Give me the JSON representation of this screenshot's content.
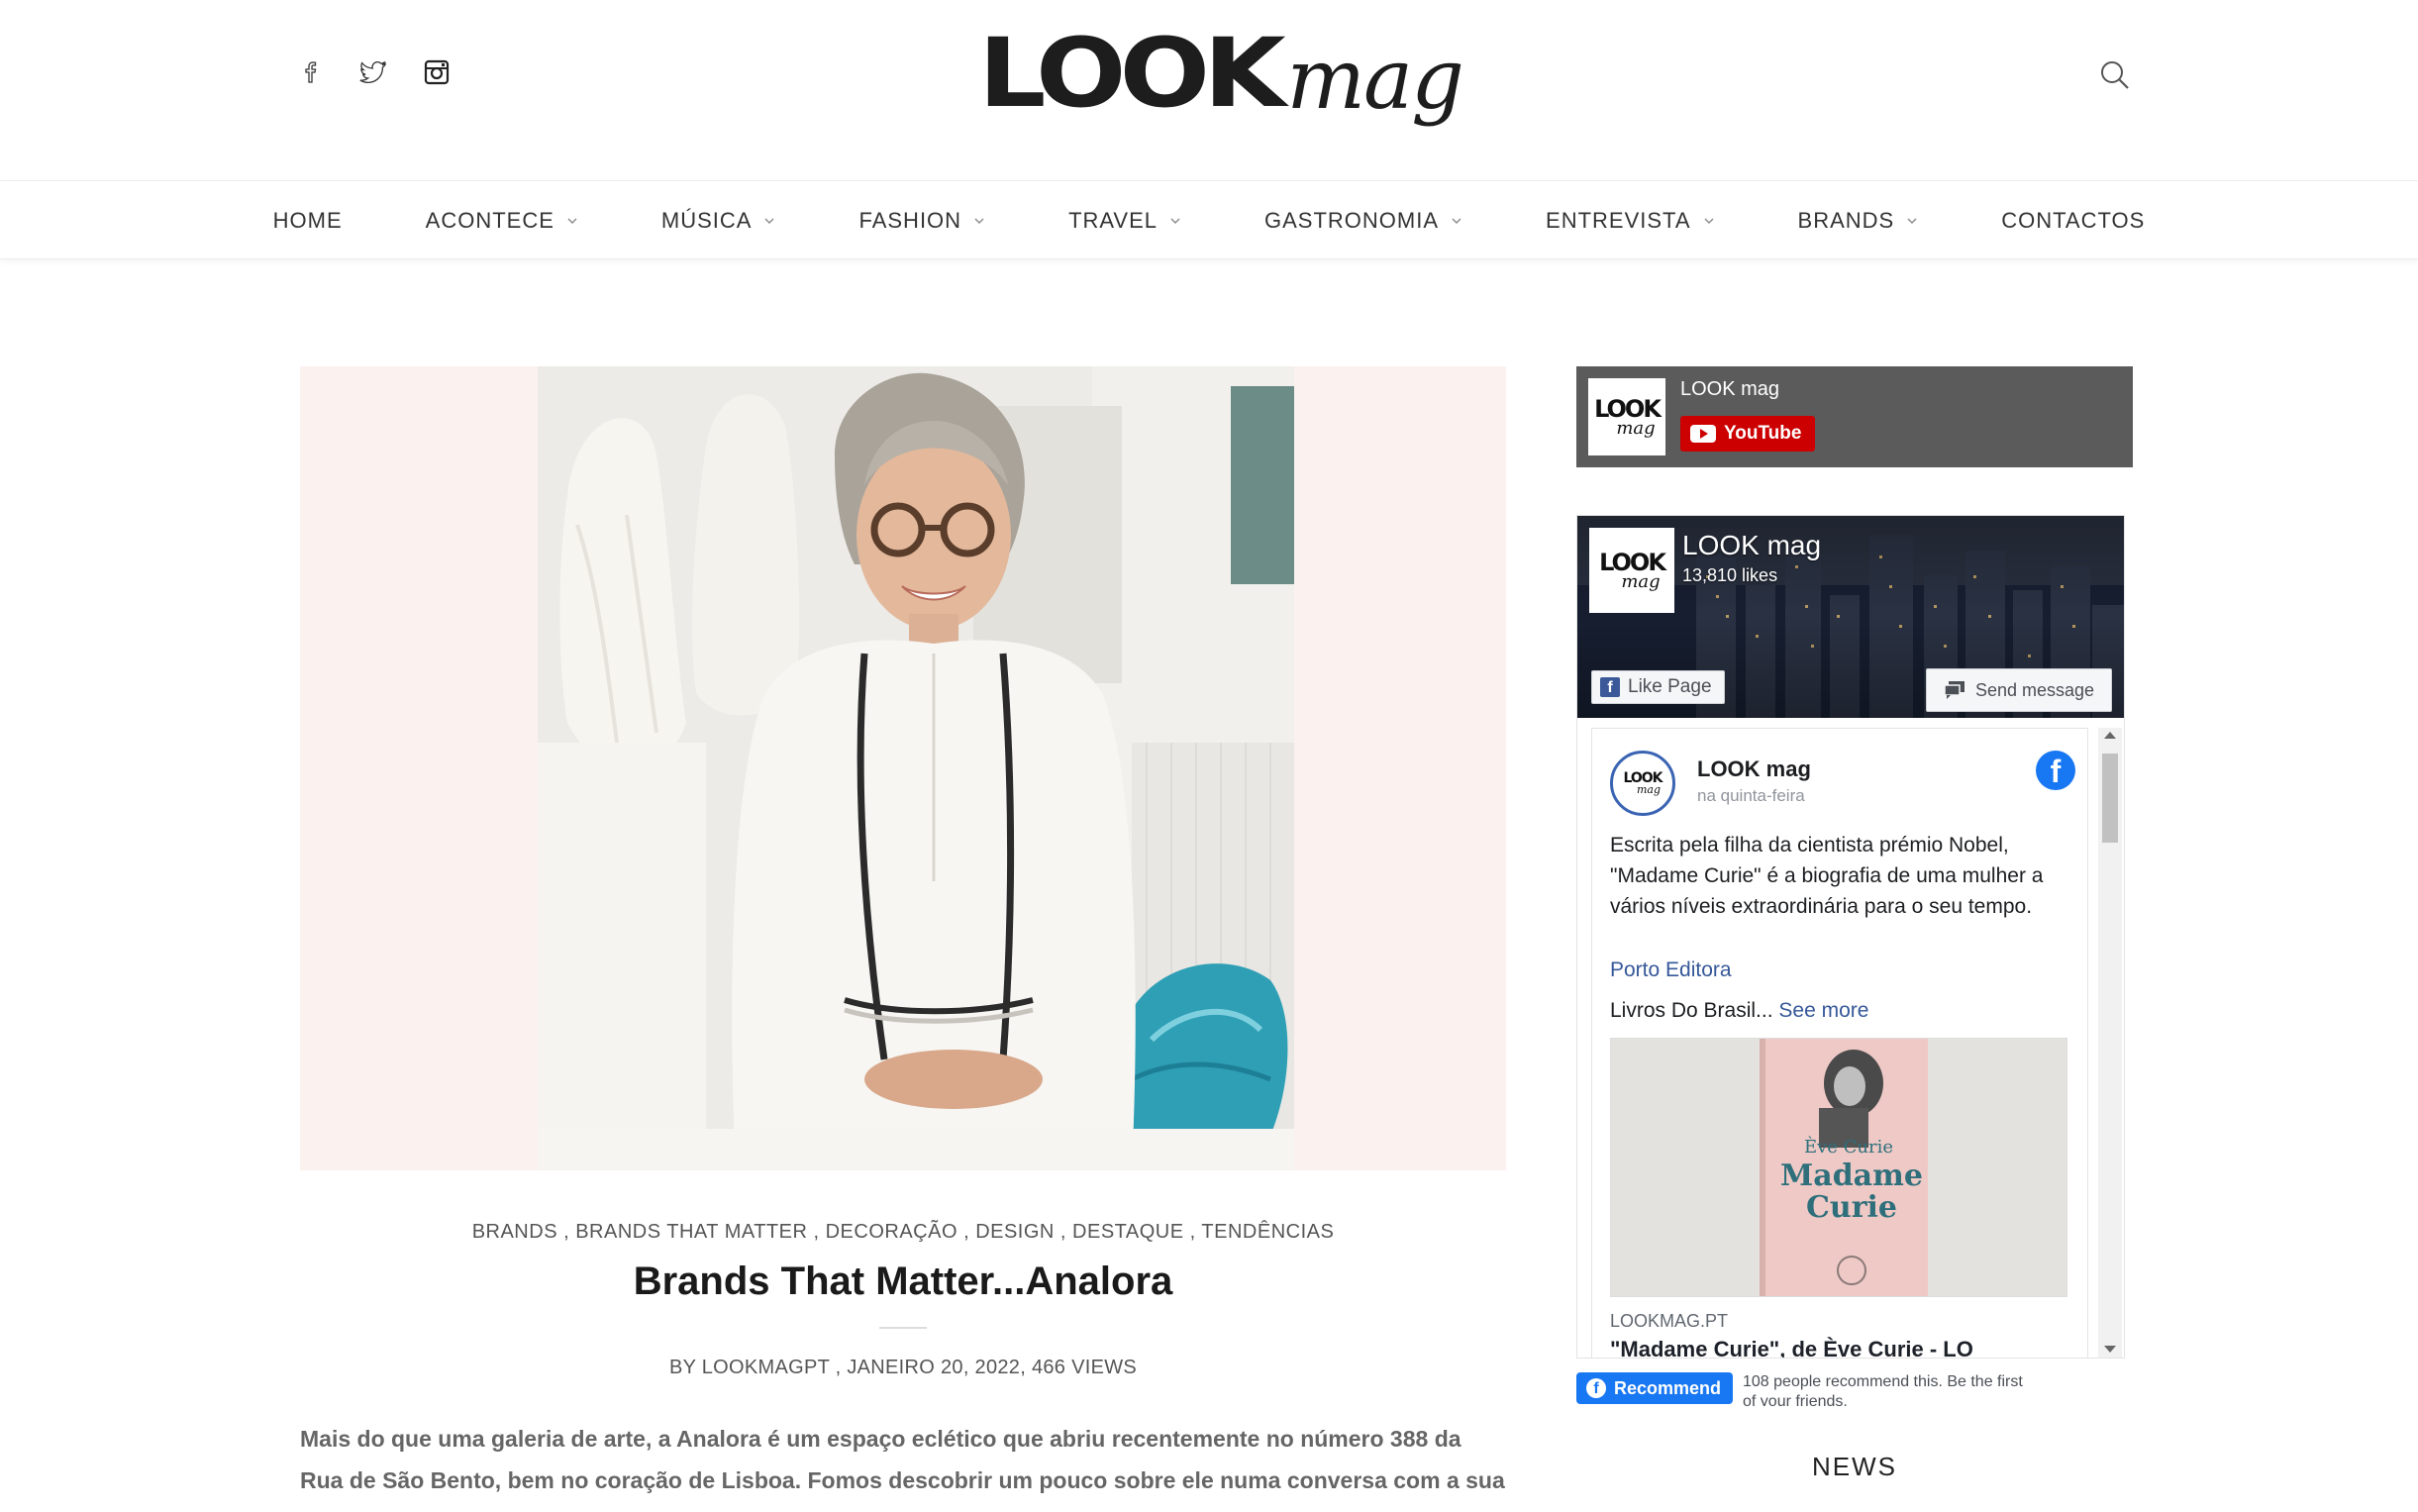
{
  "header": {
    "logo_bold": "LOOK",
    "logo_italic": "mag",
    "social_icons": [
      "facebook-icon",
      "twitter-icon",
      "instagram-icon"
    ]
  },
  "nav": {
    "items": [
      {
        "label": "HOME",
        "has_dropdown": false
      },
      {
        "label": "ACONTECE",
        "has_dropdown": true
      },
      {
        "label": "MÚSICA",
        "has_dropdown": true
      },
      {
        "label": "FASHION",
        "has_dropdown": true
      },
      {
        "label": "TRAVEL",
        "has_dropdown": true
      },
      {
        "label": "GASTRONOMIA",
        "has_dropdown": true
      },
      {
        "label": "ENTREVISTA",
        "has_dropdown": true
      },
      {
        "label": "BRANDS",
        "has_dropdown": true
      },
      {
        "label": "CONTACTOS",
        "has_dropdown": false
      }
    ]
  },
  "article": {
    "categories": [
      "BRANDS",
      "BRANDS THAT MATTER",
      "DECORAÇÃO",
      "DESIGN",
      "DESTAQUE",
      "TENDÊNCIAS"
    ],
    "title": "Brands That Matter...Analora",
    "meta": "BY LOOKMAGPT , JANEIRO 20, 2022, 466 VIEWS",
    "excerpt": "Mais do que uma galeria de arte, a Analora é um espaço eclético que abriu recentemente no número 388 da Rua de São Bento, bem no coração de Lisboa. Fomos descobrir um pouco sobre ele numa conversa com a sua"
  },
  "youtube_widget": {
    "channel_name": "LOOK mag",
    "button_label": "YouTube",
    "avatar_bold": "LOOK",
    "avatar_italic": "mag"
  },
  "facebook_widget": {
    "page_name": "LOOK mag",
    "likes": "13,810 likes",
    "like_button": "Like Page",
    "message_button": "Send message",
    "post": {
      "author": "LOOK mag",
      "time": "na quinta-feira",
      "text": "Escrita pela filha da cientista prémio Nobel, \"Madame Curie\" é a biografia de uma mulher a vários níveis extraordinária para o seu tempo.",
      "link": "Porto Editora",
      "more_text": "Livros Do Brasil...",
      "see_more": "See more",
      "book_author": "Ève Curie",
      "book_title_1": "Madame",
      "book_title_2": "Curie",
      "attachment_domain": "LOOKMAG.PT",
      "attachment_title": "\"Madame Curie\", de Ève Curie - LO"
    },
    "recommend_button": "Recommend",
    "recommend_text": "108 people recommend this. Be the first of your friends."
  },
  "sidebar": {
    "news_heading": "NEWS"
  }
}
